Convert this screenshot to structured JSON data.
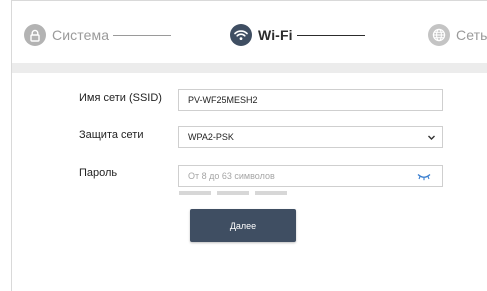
{
  "stepper": {
    "steps": [
      {
        "label": "Система",
        "state": "done",
        "icon": "lock-icon"
      },
      {
        "label": "Wi-Fi",
        "state": "active",
        "icon": "wifi-icon"
      },
      {
        "label": "Сеть",
        "state": "pending",
        "icon": "globe-icon"
      }
    ]
  },
  "form": {
    "ssid": {
      "label": "Имя сети (SSID)",
      "value": "PV-WF25MESH2"
    },
    "security": {
      "label": "Защита сети",
      "value": "WPA2-PSK"
    },
    "password": {
      "label": "Пароль",
      "value": "",
      "placeholder": "От 8 до 63 символов",
      "strength_bars": 3
    },
    "next_label": "Далее"
  },
  "colors": {
    "accent": "#3f4e62",
    "band": "#ececec",
    "inactive": "#b3b3b3"
  }
}
